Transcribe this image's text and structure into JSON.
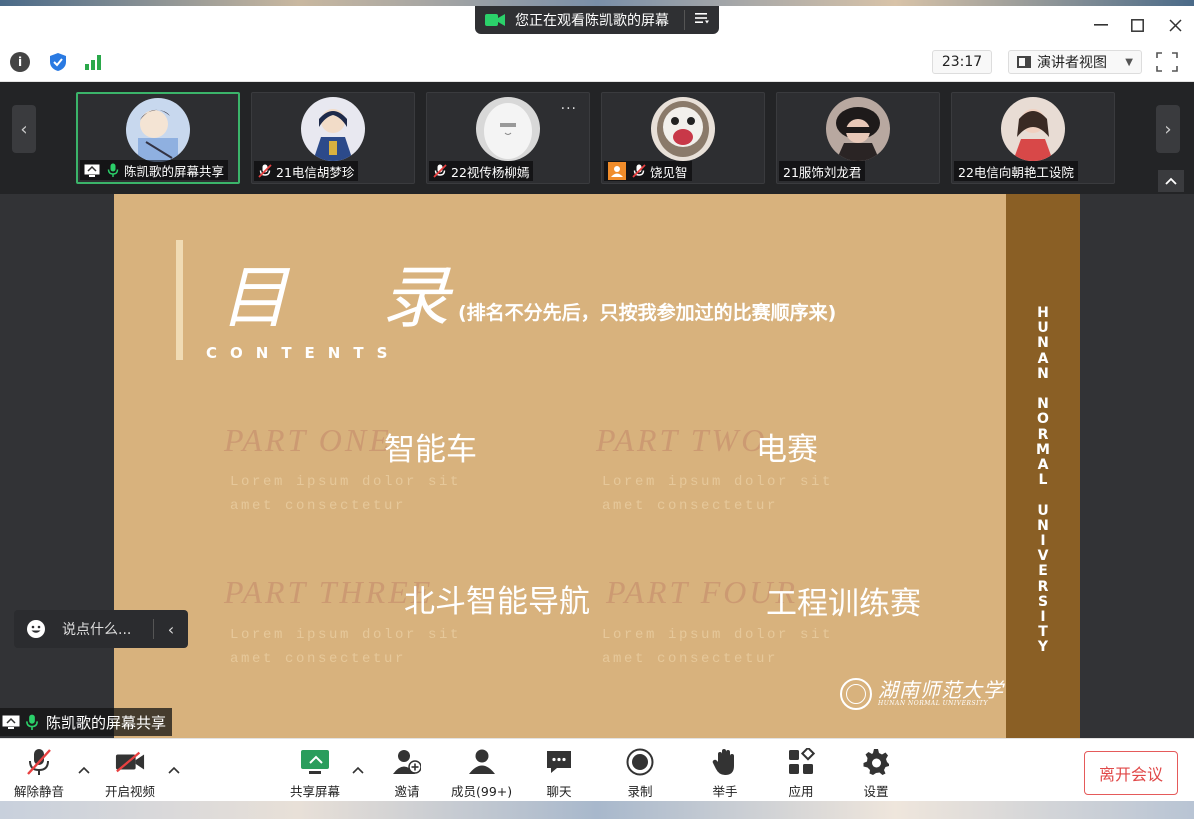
{
  "banner": {
    "text": "您正在观看陈凯歌的屏幕"
  },
  "toolbar": {
    "time": "23:17",
    "view_mode": "演讲者视图"
  },
  "participants": [
    {
      "name": "陈凯歌的屏幕共享"
    },
    {
      "name": "21电信胡梦珍"
    },
    {
      "name": "22视传杨柳嫣"
    },
    {
      "name": "饶见智"
    },
    {
      "name": "21服饰刘龙君"
    },
    {
      "name": "22电信向朝艳工设院"
    }
  ],
  "slide": {
    "title": "目 录",
    "contents": "CONTENTS",
    "subtitle": "(排名不分先后，只按我参加过的比赛顺序来)",
    "parts": [
      {
        "label": "PART  ONE",
        "title": "智能车",
        "lorem1": "Lorem ipsum dolor sit",
        "lorem2": "amet consectetur"
      },
      {
        "label": "PART  TWO",
        "title": "电赛",
        "lorem1": "Lorem ipsum dolor sit",
        "lorem2": "amet consectetur"
      },
      {
        "label": "PART  THREE",
        "title": "北斗智能导航",
        "lorem1": "Lorem ipsum dolor sit",
        "lorem2": "amet consectetur"
      },
      {
        "label": "PART  FOUR",
        "title": "工程训练赛",
        "lorem1": "Lorem ipsum dolor sit",
        "lorem2": "amet consectetur"
      }
    ],
    "vertical_text": [
      "H",
      "U",
      "N",
      "A",
      "N",
      "",
      "N",
      "O",
      "R",
      "M",
      "A",
      "L",
      "",
      "U",
      "N",
      "I",
      "V",
      "E",
      "R",
      "S",
      "I",
      "T",
      "Y"
    ],
    "logo_cn": "湖南师范大学",
    "logo_en": "HUNAN NORMAL UNIVERSITY"
  },
  "chat": {
    "placeholder": "说点什么..."
  },
  "sharer_tag": "陈凯歌的屏幕共享",
  "bottom": {
    "unmute": "解除静音",
    "start_video": "开启视频",
    "share_screen": "共享屏幕",
    "invite": "邀请",
    "members": "成员(99+)",
    "chat": "聊天",
    "record": "录制",
    "raise_hand": "举手",
    "apps": "应用",
    "settings": "设置",
    "leave": "离开会议"
  },
  "colors": {
    "slide_bg": "#d8b27d",
    "slide_bar": "#8a5f25",
    "active_border": "#3bb46a",
    "leave_red": "#e04848",
    "share_green": "#2a9d5c"
  }
}
